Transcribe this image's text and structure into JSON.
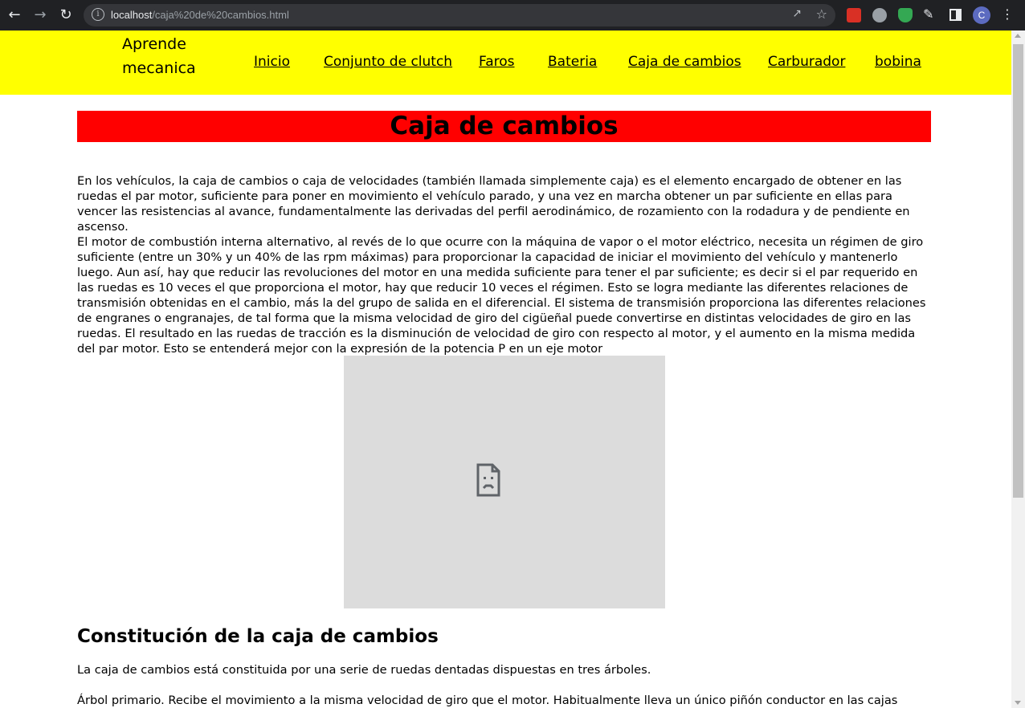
{
  "browser": {
    "url_host": "localhost",
    "url_path": "/caja%20de%20cambios.html",
    "avatar_letter": "C"
  },
  "header": {
    "logo_line1": "Aprende",
    "logo_line2": "mecanica",
    "nav": [
      "Inicio",
      "Conjunto de clutch",
      "Faros",
      "Bateria",
      "Caja de cambios",
      "Carburador",
      "bobina"
    ]
  },
  "main": {
    "title": "Caja de cambios",
    "intro_paragraphs": [
      "En los vehículos, la caja de cambios o caja de velocidades (también llamada simplemente caja) es el elemento encargado de obtener en las ruedas el par motor, suficiente para poner en movimiento el vehículo parado, y una vez en marcha obtener un par suficiente en ellas para vencer las resistencias al avance, fundamentalmente las derivadas del perfil aerodinámico, de rozamiento con la rodadura y de pendiente en ascenso.",
      "El motor de combustión interna alternativo, al revés de lo que ocurre con la máquina de vapor o el motor eléctrico, necesita un régimen de giro suficiente (entre un 30% y un 40% de las rpm máximas) para proporcionar la capacidad de iniciar el movimiento del vehículo y mantenerlo luego. Aun así, hay que reducir las revoluciones del motor en una medida suficiente para tener el par suficiente; es decir si el par requerido en las ruedas es 10 veces el que proporciona el motor, hay que reducir 10 veces el régimen. Esto se logra mediante las diferentes relaciones de transmisión obtenidas en el cambio, más la del grupo de salida en el diferencial. El sistema de transmisión proporciona las diferentes relaciones de engranes o engranajes, de tal forma que la misma velocidad de giro del cigüeñal puede convertirse en distintas velocidades de giro en las ruedas. El resultado en las ruedas de tracción es la disminución de velocidad de giro con respecto al motor, y el aumento en la misma medida del par motor. Esto se entenderá mejor con la expresión de la potencia P en un eje motor"
    ],
    "section_heading": "Constitución de la caja de cambios",
    "section_p1": "La caja de cambios está constituida por una serie de ruedas dentadas dispuestas en tres árboles.",
    "section_p2": "Árbol primario. Recibe el movimiento a la misma velocidad de giro que el motor. Habitualmente lleva un único piñón conductor en las cajas"
  }
}
